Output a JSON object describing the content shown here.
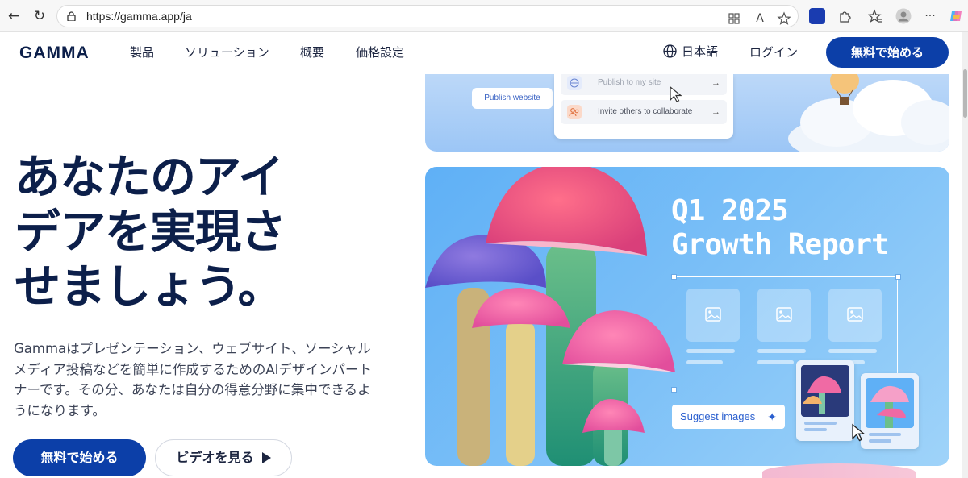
{
  "browser": {
    "url": "https://gamma.app/ja",
    "back_icon": "←",
    "refresh_icon": "↻",
    "icons": [
      "apps-icon",
      "read-aloud-icon",
      "favorite-icon",
      "extension-icon",
      "puzzle-icon",
      "favorites-icon",
      "profile-icon",
      "more-icon",
      "copilot-icon"
    ],
    "read_aloud_label": "A",
    "more_label": "···"
  },
  "header": {
    "logo": "GAMMA",
    "menu": [
      "製品",
      "ソリューション",
      "概要",
      "価格設定"
    ],
    "language": "日本語",
    "login": "ログイン",
    "cta": "無料で始める"
  },
  "hero": {
    "title_lines": [
      "あなたのアイ",
      "デアを実現さ",
      "せましょう。"
    ],
    "description_lines": [
      "Gammaはプレゼンテーション、ウェブサイト、ソーシャル",
      "メディア投稿などを簡単に作成するためのAIデザインパート",
      "ナーです。その分、あなたは自分の得意分野に集中できるよ",
      "うになります。"
    ],
    "primary_button": "無料で始める",
    "secondary_button": "ビデオを見る"
  },
  "top_card": {
    "publish_button": "Publish website",
    "share_rows": [
      "Publish to my site",
      "Invite others to collaborate"
    ],
    "arrow": "→"
  },
  "main_card": {
    "title_line1": "Q1 2025",
    "title_line2": "Growth Report",
    "suggest_button": "Suggest images",
    "sparkle": "✦"
  },
  "colors": {
    "brand_navy": "#0c1f4a",
    "cta_blue": "#0c3fa8",
    "card_sky": "#6cb6f6",
    "mushroom_pink": "#f0508a",
    "stem_green": "#2e9f7e"
  }
}
